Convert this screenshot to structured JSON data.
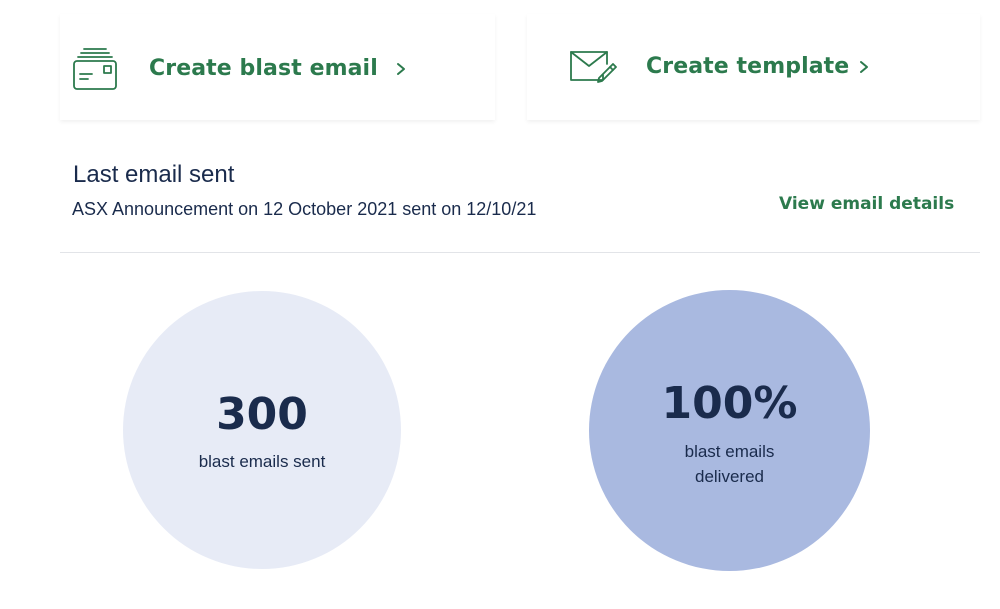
{
  "actions": {
    "blast": {
      "label": "Create blast email",
      "icon": "blast-email-icon"
    },
    "template": {
      "label": "Create template",
      "icon": "envelope-pencil-icon"
    }
  },
  "last_email": {
    "title": "Last email sent",
    "subtitle": "ASX Announcement on 12 October 2021 sent on 12/10/21",
    "link": "View email details"
  },
  "stats": {
    "sent": {
      "value": "300",
      "label": "blast emails sent"
    },
    "delivered": {
      "value": "100%",
      "label": "blast emails delivered"
    }
  },
  "colors": {
    "accent": "#2c7a4d",
    "text": "#1a2b4c",
    "circle_light": "#e7ebf6",
    "circle_dark": "#a9b9e0"
  }
}
